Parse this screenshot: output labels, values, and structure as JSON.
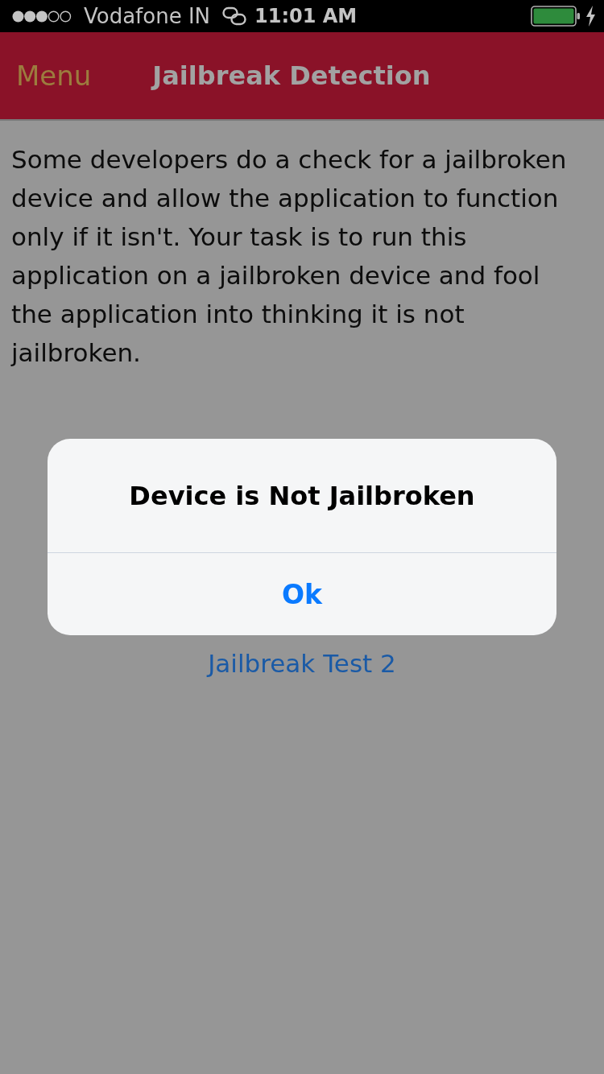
{
  "status_bar": {
    "carrier": "Vodafone IN",
    "time": "11:01 AM"
  },
  "nav_bar": {
    "left_button": "Menu",
    "title": "Jailbreak Detection"
  },
  "description": "Some developers do a check for a jailbroken device and allow the application to function only if it isn't. Your task is to run this application on a jailbroken device and fool the application into thinking it is not jailbroken.",
  "buttons": [
    {
      "label": "Jailbreak Test 2"
    }
  ],
  "alert": {
    "title": "Device is Not Jailbroken",
    "actions": [
      {
        "label": "Ok"
      }
    ]
  }
}
